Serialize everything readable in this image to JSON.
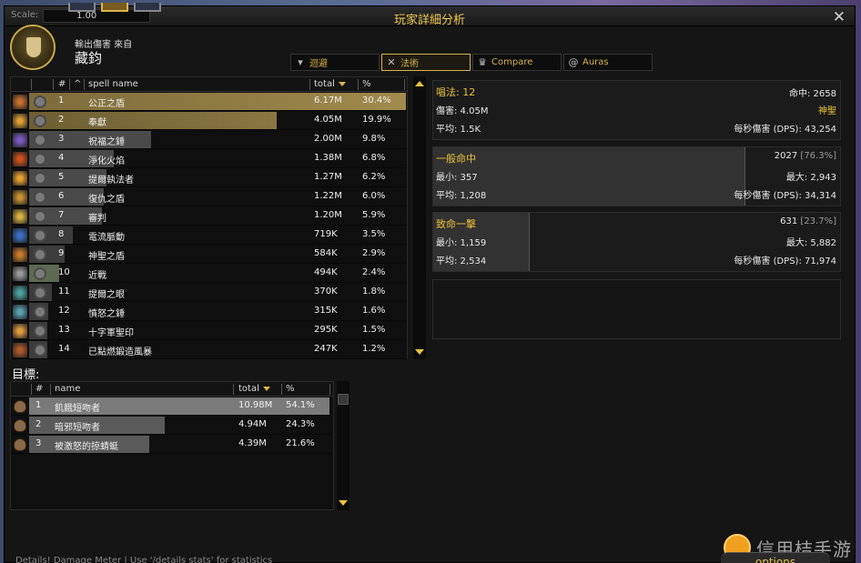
{
  "colors": {
    "accent_gold": "#e8c23a",
    "spell_bar_gold": "#a08a4c",
    "window_bg": "#151515"
  },
  "top_bar": {
    "scale_label": "Scale:",
    "scale_value": "1.00"
  },
  "window": {
    "title": "玩家詳細分析",
    "close_icon": "close-icon"
  },
  "header": {
    "source_label": "輸出傷害 來自",
    "player_name": "藏鈞"
  },
  "tabs": [
    {
      "label": "迴避",
      "icon": "armor-icon",
      "active": false
    },
    {
      "label": "法術",
      "icon": "crossed-swords-icon",
      "active": true
    },
    {
      "label": "Compare",
      "icon": "crown-icon",
      "active": false
    },
    {
      "label": "Auras",
      "icon": "swirl-icon",
      "active": false
    }
  ],
  "spell_table": {
    "headers": {
      "hash": "#",
      "caret": "^",
      "name": "spell name",
      "total": "total",
      "pct": "%"
    },
    "rows": [
      {
        "idx": "1",
        "name": "公正之盾",
        "total": "6.17M",
        "pct": "30.4%",
        "fill": 1.0,
        "icon_color": "#c9702a"
      },
      {
        "idx": "2",
        "name": "奉獻",
        "total": "4.05M",
        "pct": "19.9%",
        "fill": 0.656,
        "icon_color": "#e0a030"
      },
      {
        "idx": "3",
        "name": "祝福之錘",
        "total": "2.00M",
        "pct": "9.8%",
        "fill": 0.324,
        "icon_color": "#7b5bc2"
      },
      {
        "idx": "4",
        "name": "淨化火焰",
        "total": "1.38M",
        "pct": "6.8%",
        "fill": 0.224,
        "icon_color": "#d0501c"
      },
      {
        "idx": "5",
        "name": "提爾執法者",
        "total": "1.27M",
        "pct": "6.2%",
        "fill": 0.206,
        "icon_color": "#e8a030"
      },
      {
        "idx": "6",
        "name": "復仇之盾",
        "total": "1.22M",
        "pct": "6.0%",
        "fill": 0.198,
        "icon_color": "#c99030"
      },
      {
        "idx": "7",
        "name": "審判",
        "total": "1.20M",
        "pct": "5.9%",
        "fill": 0.194,
        "icon_color": "#d8b040"
      },
      {
        "idx": "8",
        "name": "電流脈動",
        "total": "719K",
        "pct": "3.5%",
        "fill": 0.117,
        "icon_color": "#3a70c8"
      },
      {
        "idx": "9",
        "name": "神聖之盾",
        "total": "584K",
        "pct": "2.9%",
        "fill": 0.095,
        "icon_color": "#c87a2a"
      },
      {
        "idx": "10",
        "name": "近戰",
        "total": "494K",
        "pct": "2.4%",
        "fill": 0.08,
        "icon_color": "#9a9a9a"
      },
      {
        "idx": "11",
        "name": "提爾之眼",
        "total": "370K",
        "pct": "1.8%",
        "fill": 0.06,
        "icon_color": "#4aa0a0"
      },
      {
        "idx": "12",
        "name": "憤怒之錘",
        "total": "315K",
        "pct": "1.6%",
        "fill": 0.051,
        "icon_color": "#5aa0b0"
      },
      {
        "idx": "13",
        "name": "十字軍聖印",
        "total": "295K",
        "pct": "1.5%",
        "fill": 0.048,
        "icon_color": "#e09a40"
      },
      {
        "idx": "14",
        "name": "已點燃鍛造風暴",
        "total": "247K",
        "pct": "1.2%",
        "fill": 0.04,
        "icon_color": "#b05a2a"
      }
    ]
  },
  "summary": {
    "casts_label": "唱法: 12",
    "hits": "命中: 2658",
    "damage": "傷害: 4.05M",
    "school": "神聖",
    "average": "平均: 1.5K",
    "dps": "每秒傷害 (DPS): 43,254"
  },
  "normal_hits": {
    "title": "一般命中",
    "count": "2027",
    "pct": "[76.3%]",
    "min": "最小: 357",
    "max": "最大: 2,943",
    "average": "平均: 1,208",
    "dps": "每秒傷害 (DPS): 34,314",
    "fill": 0.763
  },
  "critical_hits": {
    "title": "致命一擊",
    "count": "631",
    "pct": "[23.7%]",
    "min": "最小: 1,159",
    "max": "最大: 5,882",
    "average": "平均: 2,534",
    "dps": "每秒傷害 (DPS): 71,974",
    "fill": 0.237
  },
  "targets": {
    "title": "目標:",
    "headers": {
      "hash": "#",
      "name": "name",
      "total": "total",
      "pct": "%"
    },
    "rows": [
      {
        "idx": "1",
        "name": "飢餓短吻者",
        "total": "10.98M",
        "pct": "54.1%",
        "fill": 1.0
      },
      {
        "idx": "2",
        "name": "暗邪短吻者",
        "total": "4.94M",
        "pct": "24.3%",
        "fill": 0.45
      },
      {
        "idx": "3",
        "name": "被激怒的掠蜻蜓",
        "total": "4.39M",
        "pct": "21.6%",
        "fill": 0.4
      }
    ]
  },
  "footer": {
    "status_text": "Details! Damage Meter | Use '/details stats' for statistics",
    "options_label": "options"
  },
  "watermark": {
    "text": "信用桔手游"
  }
}
